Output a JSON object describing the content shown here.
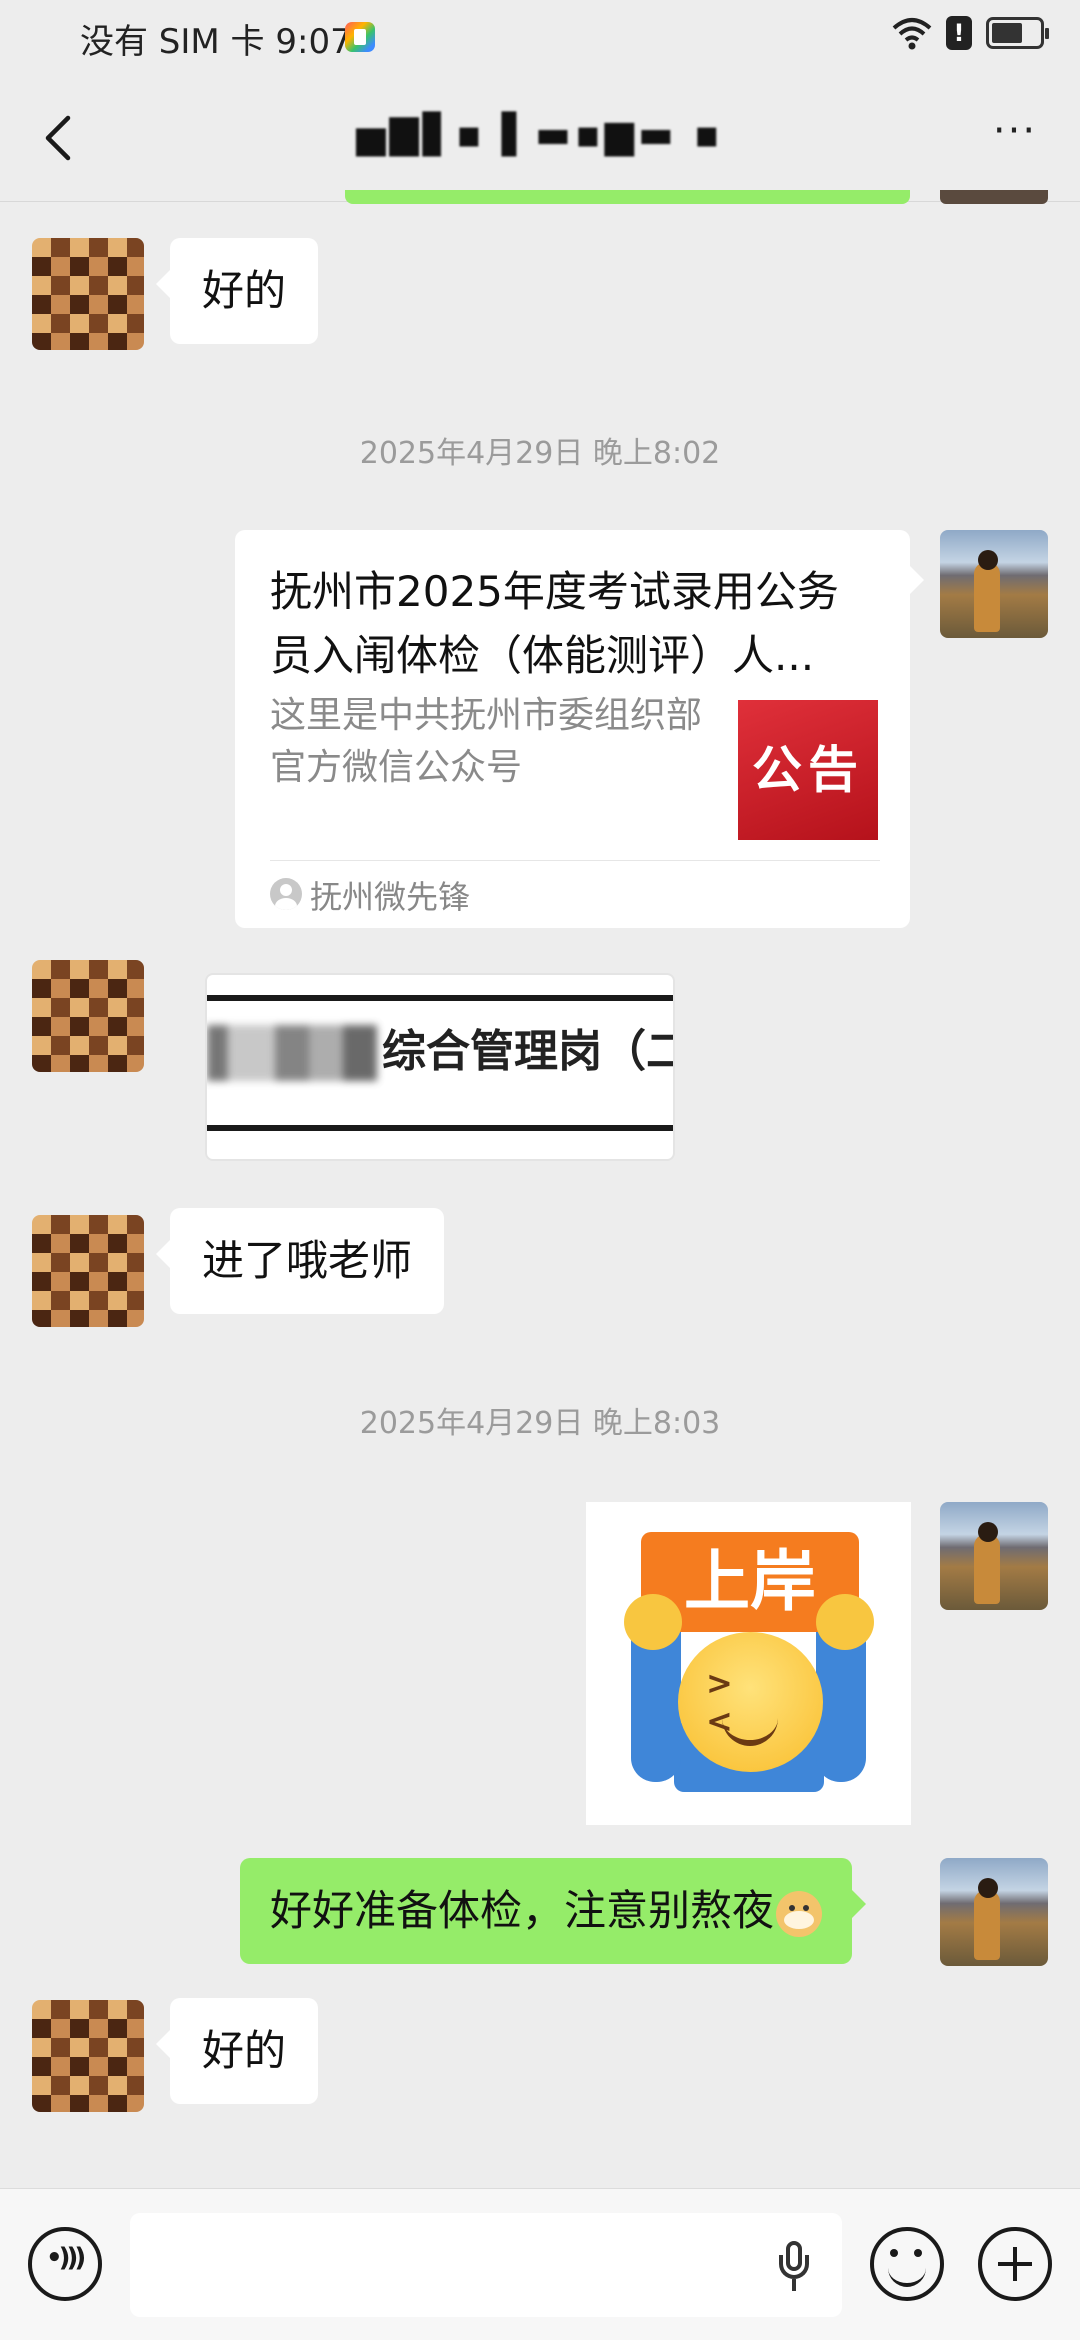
{
  "status_bar": {
    "carrier_time": "没有 SIM 卡 9:07",
    "alert_symbol": "!",
    "icons": [
      "app-notification-icon",
      "wifi-icon",
      "alert-icon",
      "battery-charging-icon"
    ]
  },
  "nav": {
    "title": "▅▇▋▪ ▌▬▪▆▬    ▪",
    "more_label": "···",
    "icons": [
      "back-icon",
      "more-icon"
    ]
  },
  "messages": [
    {
      "type": "text",
      "side": "left",
      "text": "好的"
    },
    {
      "type": "timestamp",
      "text": "2025年4月29日 晚上8:02"
    },
    {
      "type": "article",
      "side": "right",
      "title": "抚州市2025年度考试录用公务员入闱体检（体能测评）人...",
      "description": "这里是中共抚州市委组织部官方微信公众号",
      "thumbnail_text": "公告",
      "source": "抚州微先锋"
    },
    {
      "type": "image",
      "side": "left",
      "visible_text": "综合管理岗（二"
    },
    {
      "type": "text",
      "side": "left",
      "text": "进了哦老师"
    },
    {
      "type": "timestamp",
      "text": "2025年4月29日 晚上8:03"
    },
    {
      "type": "sticker",
      "side": "right",
      "sticker_text": "上岸"
    },
    {
      "type": "text",
      "side": "right",
      "text": "好好准备体检，注意别熬夜"
    },
    {
      "type": "text",
      "side": "left",
      "text": "好的"
    }
  ],
  "input_bar": {
    "placeholder": "",
    "icons": [
      "voice-icon",
      "mic-icon",
      "emoji-icon",
      "plus-icon"
    ]
  },
  "colors": {
    "background": "#ededed",
    "sent_bubble": "#95ec69",
    "received_bubble": "#ffffff",
    "timestamp_text": "#9b9b9b",
    "thumbnail_red": "#d1242d"
  }
}
